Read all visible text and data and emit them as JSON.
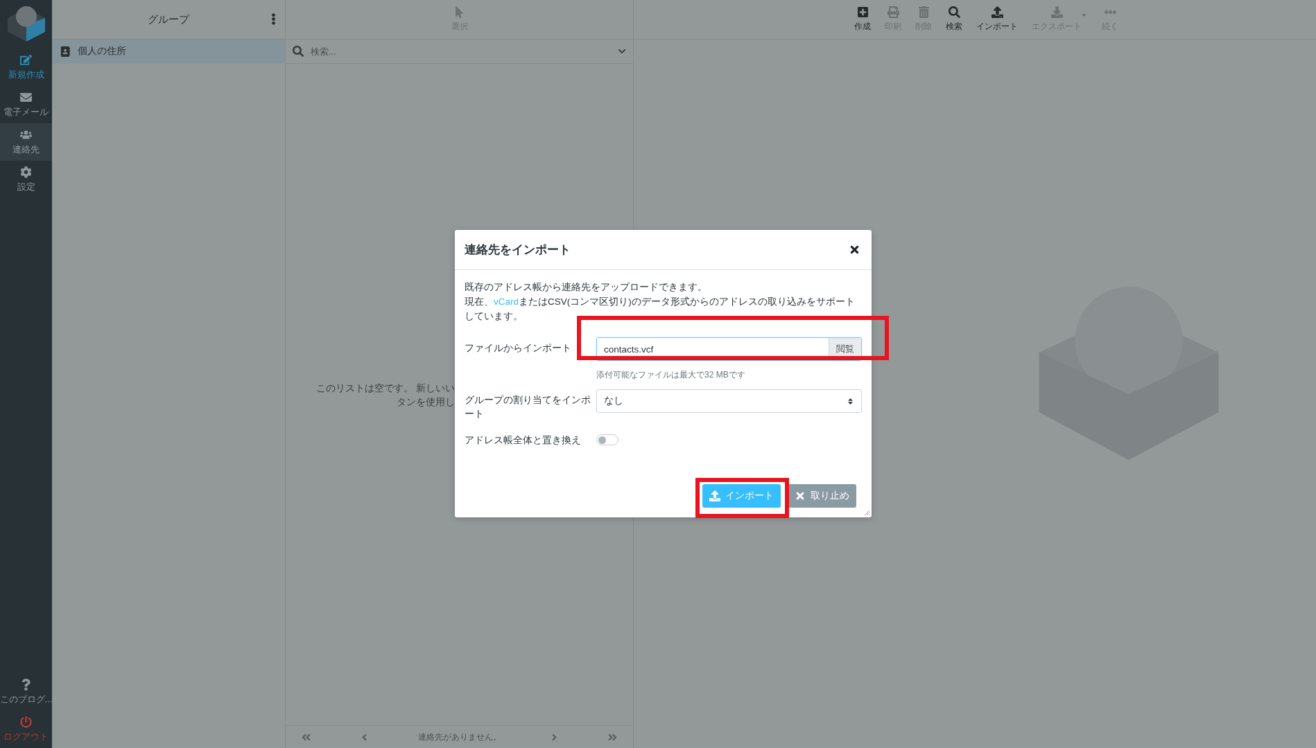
{
  "sidebar": {
    "items": [
      {
        "label": "新規作成",
        "kind": "primary",
        "selected": false
      },
      {
        "label": "電子メール",
        "kind": "normal",
        "selected": false
      },
      {
        "label": "連絡先",
        "kind": "normal",
        "selected": true
      },
      {
        "label": "設定",
        "kind": "normal",
        "selected": false
      }
    ],
    "bottom_items": [
      {
        "label": "このブログ...",
        "kind": "normal"
      },
      {
        "label": "ログアウト",
        "kind": "danger"
      }
    ]
  },
  "groups": {
    "title": "グループ",
    "items": [
      {
        "label": "個人の住所",
        "selected": true
      }
    ]
  },
  "list": {
    "toolbar": [
      {
        "label": "選択",
        "disabled": true
      }
    ],
    "search": {
      "placeholder": "検索..."
    },
    "empty_text": [
      "このリストは空です。 新しいい",
      "タンを使用し"
    ],
    "pager": {
      "status": "連絡先がありません。"
    }
  },
  "toolbar": [
    {
      "label": "作成",
      "disabled": false
    },
    {
      "label": "印刷",
      "disabled": true
    },
    {
      "label": "削除",
      "disabled": true
    },
    {
      "label": "検索",
      "disabled": false
    },
    {
      "label": "インポート",
      "disabled": false
    },
    {
      "label": "エクスポート",
      "disabled": true
    },
    {
      "label": "続く",
      "disabled": true
    }
  ],
  "dialog": {
    "title": "連絡先をインポート",
    "intro": {
      "line1": "既存のアドレス帳から連絡先をアップロードできます。",
      "prefix": "現在、",
      "link": "vCard",
      "suffix": "またはCSV(コンマ区切り)のデータ形式からのアドレスの取り込みをサポートしています。"
    },
    "fields": [
      {
        "label": "ファイルからインポート",
        "kind": "file",
        "value": "contacts.vcf",
        "button": "閲覧",
        "hint": "添付可能なファイルは最大で32 MBです"
      },
      {
        "label": "グループの割り当てをインポート",
        "kind": "select",
        "value": "なし"
      },
      {
        "label": "アドレス帳全体と置き換え",
        "kind": "toggle",
        "on": false
      }
    ],
    "buttons": [
      {
        "label": "インポート",
        "kind": "primary"
      },
      {
        "label": "取り止め",
        "kind": "secondary"
      }
    ]
  }
}
